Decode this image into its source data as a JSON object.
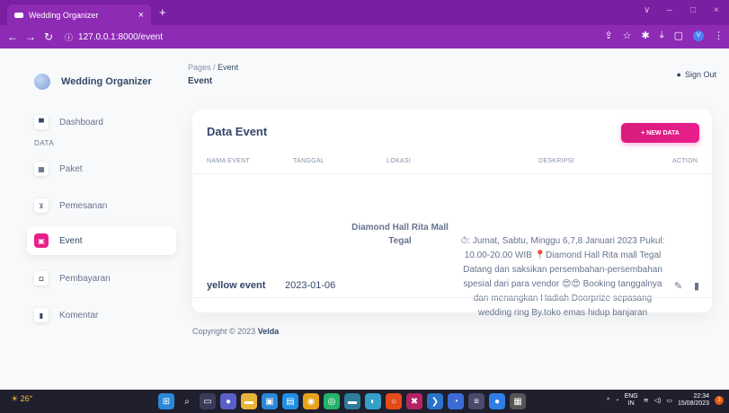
{
  "browser": {
    "tab_title": "Wedding Organizer",
    "tab_close": "×",
    "new_tab": "+",
    "url": "127.0.0.1:8000/event",
    "win_controls": [
      "∨",
      "–",
      "□",
      "×"
    ],
    "profile_initial": "V"
  },
  "sidebar": {
    "brand": "Wedding Organizer",
    "section_label": "DATA",
    "items": [
      {
        "label": "Dashboard",
        "icon": "store-icon",
        "glyph": "▀",
        "active": false
      },
      {
        "label": "Paket",
        "icon": "package-icon",
        "glyph": "▦",
        "active": false
      },
      {
        "label": "Pemesanan",
        "icon": "cart-icon",
        "glyph": "⊻",
        "active": false
      },
      {
        "label": "Event",
        "icon": "calendar-icon",
        "glyph": "▣",
        "active": true
      },
      {
        "label": "Pembayaran",
        "icon": "money-icon",
        "glyph": "◘",
        "active": false
      },
      {
        "label": "Komentar",
        "icon": "comment-icon",
        "glyph": "▮",
        "active": false
      }
    ]
  },
  "header": {
    "breadcrumb_root": "Pages",
    "breadcrumb_sep": "/",
    "breadcrumb_current": "Event",
    "page_title": "Event",
    "signout": "Sign Out"
  },
  "card": {
    "title": "Data Event",
    "new_button": "+ NEW DATA",
    "columns": [
      "NAMA EVENT",
      "TANGGAL",
      "LOKASI",
      "DESKRIPSI",
      "ACTION"
    ],
    "rows": [
      {
        "nama_event": "yellow event",
        "tanggal": "2023-01-06",
        "lokasi": "Diamond Hall Rita Mall Tegal",
        "deskripsi": "⏱: Jumat, Sabtu, Minggu 6,7,8 Januari 2023 Pukul: 10.00-20.00 WIB 📍Diamond Hall Rita mall Tegal Datang dan saksikan persembahan-persembahan spesial dari para vendor 😍😍 Booking tanggalnya dan menangkan Hadiah Doorprize sepasang wedding ring By.toko emas hidup banjaran"
      }
    ]
  },
  "footer": {
    "prefix": "Copyright © 2023",
    "author": "Velda"
  },
  "taskbar": {
    "temperature": "26°",
    "lang_top": "ENG",
    "lang_bottom": "IN",
    "time": "22:34",
    "date": "15/08/2023",
    "notifications": "3"
  },
  "colors": {
    "browser_purple": "#8e2bb5",
    "accent_pink": "#e91e8c",
    "text_dark": "#344767",
    "text_muted": "#67748e"
  }
}
